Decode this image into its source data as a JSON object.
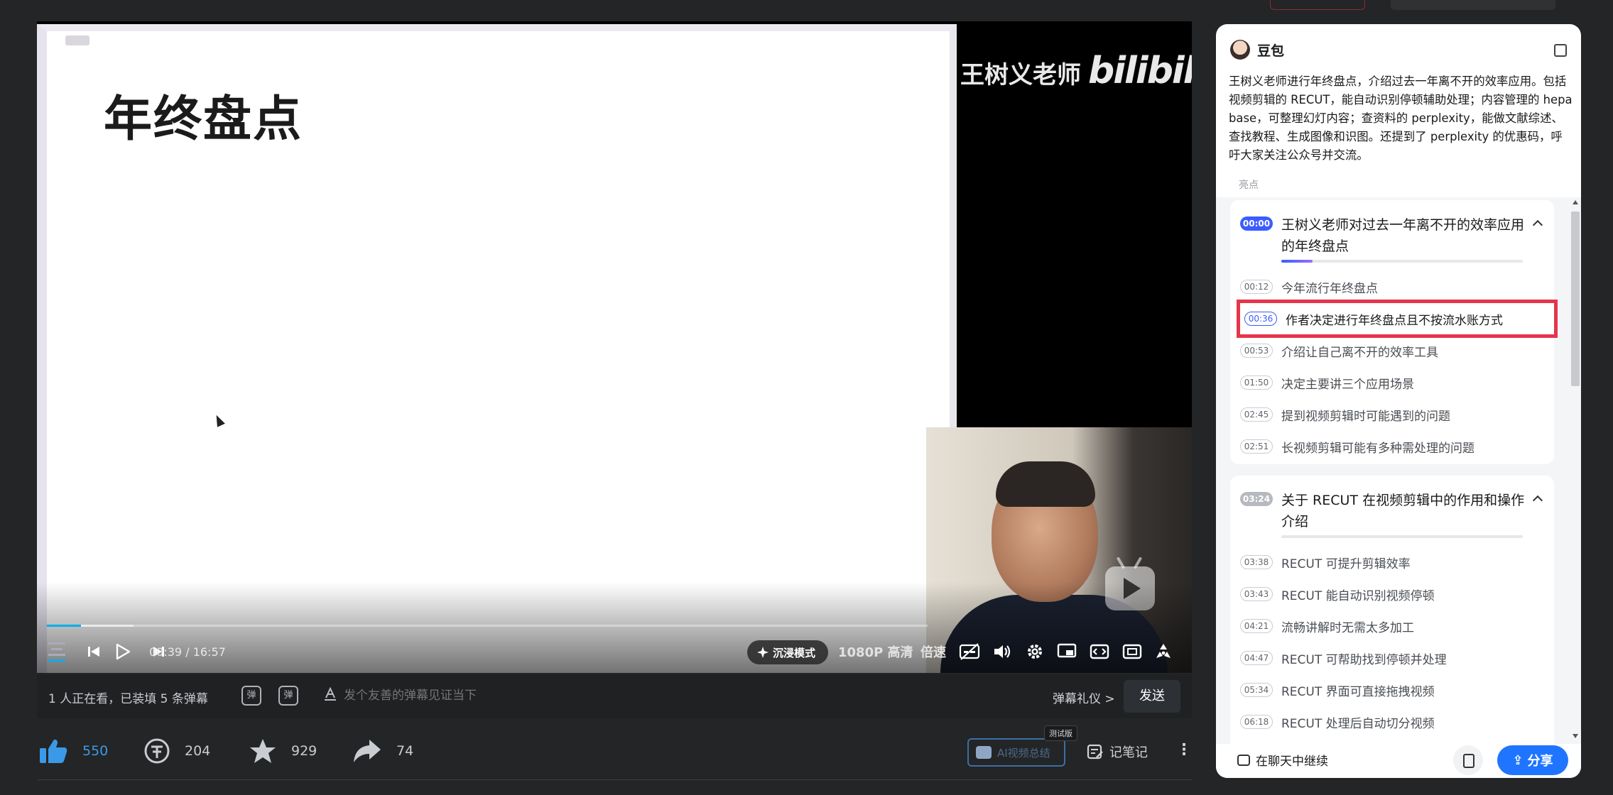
{
  "player": {
    "slide_title": "年终盘点",
    "watermark_name": "王树义老师",
    "watermark_brand": "bilibili",
    "time_current": "00:39",
    "time_separator": "/",
    "time_total": "16:57",
    "progress_played": 0.039,
    "progress_buffered": 0.098,
    "immersive_label": "沉浸模式",
    "quality_label": "1080P 高清",
    "speed_label": "倍速"
  },
  "danmaku": {
    "watch_info": "1 人正在看，已装填 5 条弹幕",
    "input_placeholder": "发个友善的弹幕见证当下",
    "etiquette_label": "弹幕礼仪 >",
    "send_label": "发送",
    "toggle_label": "弹",
    "settings_label": "弹"
  },
  "actions": {
    "like_count": "550",
    "coin_count": "204",
    "fav_count": "929",
    "share_count": "74",
    "ai_summary_label": "AI视频总结",
    "ai_tag": "测试版",
    "notes_label": "记笔记",
    "more_label": "⋮"
  },
  "panel": {
    "assistant_name": "豆包",
    "summary": "王树义老师进行年终盘点，介绍过去一年离不开的效率应用。包括视频剪辑的 RECUT，能自动识别停顿辅助处理；内容管理的 hepa base，可整理幻灯内容；查资料的 perplexity，能做文献综述、查找教程、生成图像和识图。还提到了 perplexity 的优惠码，呼吁大家关注公众号并交流。",
    "highlights_label": "亮点",
    "sections": [
      {
        "time": "00:00",
        "title": "王树义老师对过去一年离不开的效率应用的年终盘点",
        "progress": 0.13,
        "items": [
          {
            "time": "00:12",
            "text": "今年流行年终盘点"
          },
          {
            "time": "00:36",
            "text": "作者决定进行年终盘点且不按流水账方式"
          },
          {
            "time": "00:53",
            "text": "介绍让自己离不开的效率工具"
          },
          {
            "time": "01:50",
            "text": "决定主要讲三个应用场景"
          },
          {
            "time": "02:45",
            "text": "提到视频剪辑时可能遇到的问题"
          },
          {
            "time": "02:51",
            "text": "长视频剪辑可能有多种需处理的问题"
          }
        ]
      },
      {
        "time": "03:24",
        "title": "关于 RECUT 在视频剪辑中的作用和操作介绍",
        "progress": 0,
        "items": [
          {
            "time": "03:38",
            "text": "RECUT 可提升剪辑效率"
          },
          {
            "time": "03:43",
            "text": "RECUT 能自动识别视频停顿"
          },
          {
            "time": "04:21",
            "text": "流畅讲解时无需太多加工"
          },
          {
            "time": "04:47",
            "text": "RECUT 可帮助找到停顿并处理"
          },
          {
            "time": "05:34",
            "text": "RECUT 界面可直接拖拽视频"
          },
          {
            "time": "06:18",
            "text": "RECUT 处理后自动切分视频"
          }
        ]
      }
    ],
    "continue_label": "在聊天中继续",
    "share_label": "分享"
  },
  "colors": {
    "accent_blue": "#3b5cff",
    "share_blue": "#1f75ff",
    "highlight_red": "#e5354b",
    "bilibili_progress": "#00aeec"
  }
}
